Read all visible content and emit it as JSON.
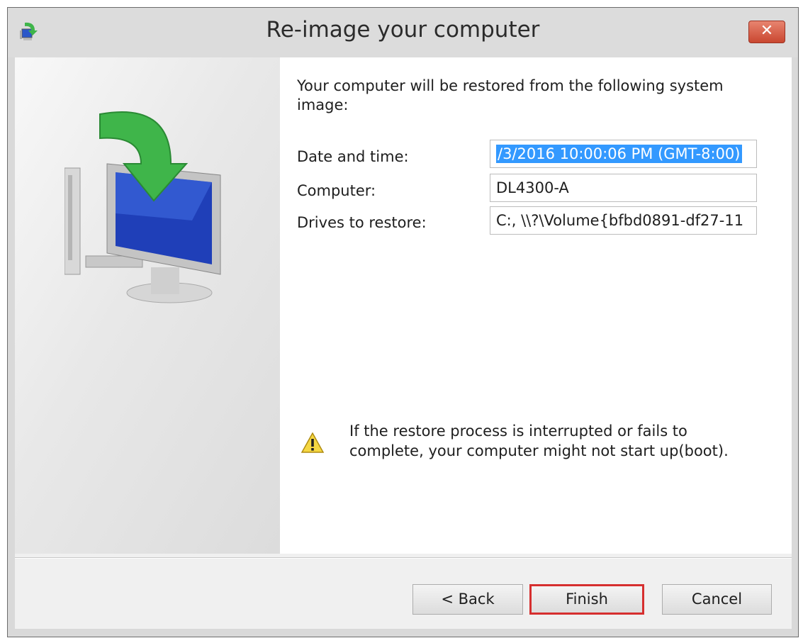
{
  "window": {
    "title": "Re-image your computer",
    "close_label": "✕",
    "app_icon": "system-restore-icon"
  },
  "content": {
    "intro": "Your computer will be restored from the following system image:",
    "fields": [
      {
        "label": "Date and time:",
        "value": "/3/2016 10:00:06 PM (GMT-8:00)"
      },
      {
        "label": "Computer:",
        "value": "DL4300-A"
      },
      {
        "label": "Drives to restore:",
        "value": "C:, \\\\?\\Volume{bfbd0891-df27-11"
      }
    ],
    "warning": {
      "icon": "warning-icon",
      "line1": "If the restore process is interrupted or fails to",
      "line2": "complete, your computer might not start up(boot)."
    }
  },
  "buttons": {
    "back": "< Back",
    "finish": "Finish",
    "cancel": "Cancel"
  },
  "colors": {
    "selection": "#3399ff",
    "focus_highlight": "#d62f2f",
    "close_button": "#c94730"
  }
}
